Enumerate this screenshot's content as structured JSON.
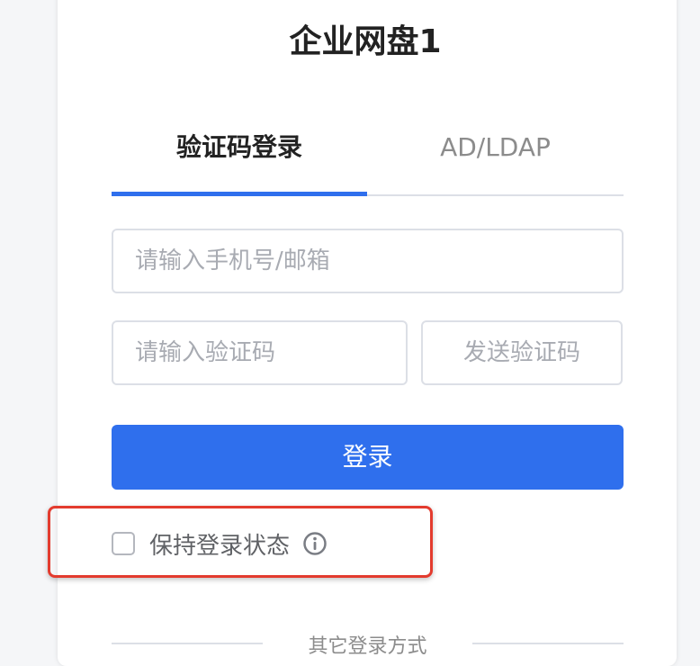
{
  "app": {
    "title": "企业网盘1"
  },
  "tabs": [
    {
      "label": "验证码登录",
      "active": true
    },
    {
      "label": "AD/LDAP",
      "active": false
    }
  ],
  "form": {
    "phone_placeholder": "请输入手机号/邮箱",
    "code_placeholder": "请输入验证码",
    "send_code_label": "发送验证码",
    "login_label": "登录",
    "remember_label": "保持登录状态",
    "remember_checked": false
  },
  "other": {
    "label": "其它登录方式"
  },
  "colors": {
    "accent": "#2f6fed",
    "highlight": "#e33b2e"
  },
  "icons": {
    "info": "info-icon"
  }
}
